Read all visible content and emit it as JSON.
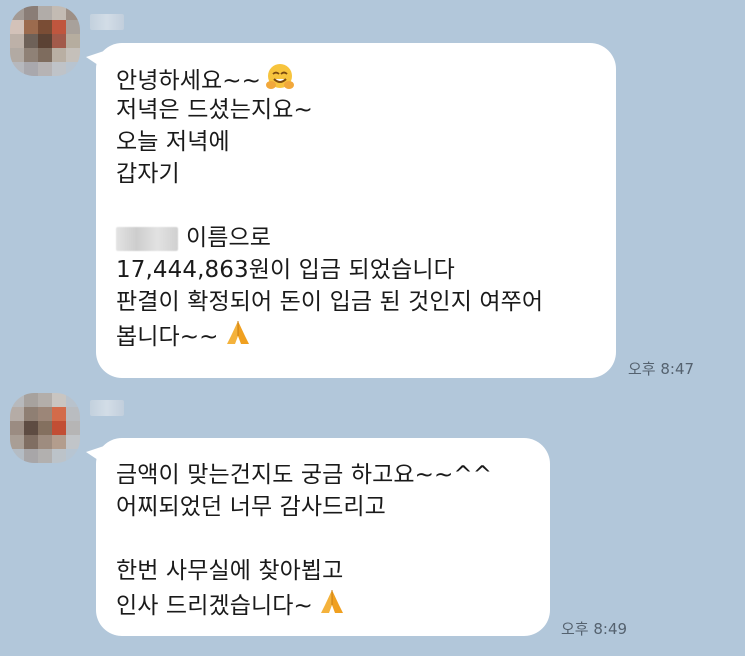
{
  "messages": [
    {
      "lines_before": [
        "안녕하세요~~",
        "저녁은 드셨는지요~",
        "오늘 저녁에",
        "갑자기"
      ],
      "greeting_emoji": "smiling-face-with-hugging-hands-icon",
      "name_suffix": "이름으로",
      "lines_after": [
        "17,444,863원이 입금 되었습니다",
        "판결이 확정되어 돈이 입금 된 것인지 여쭈어"
      ],
      "closing_line": "봅니다~~",
      "closing_emoji": "folded-hands-icon",
      "time": "오후 8:47"
    },
    {
      "lines": [
        "금액이 맞는건지도 궁금 하고요~~^^",
        "어찌되었던 너무 감사드리고"
      ],
      "lines_after": [
        "한번 사무실에 찾아뵙고"
      ],
      "closing_line": "인사 드리겠습니다~",
      "closing_emoji": "folded-hands-icon",
      "time": "오후 8:49"
    }
  ],
  "colors": {
    "background": "#b2c7da",
    "bubble": "#ffffff",
    "text": "#1a1a1a",
    "time": "#55626f"
  }
}
